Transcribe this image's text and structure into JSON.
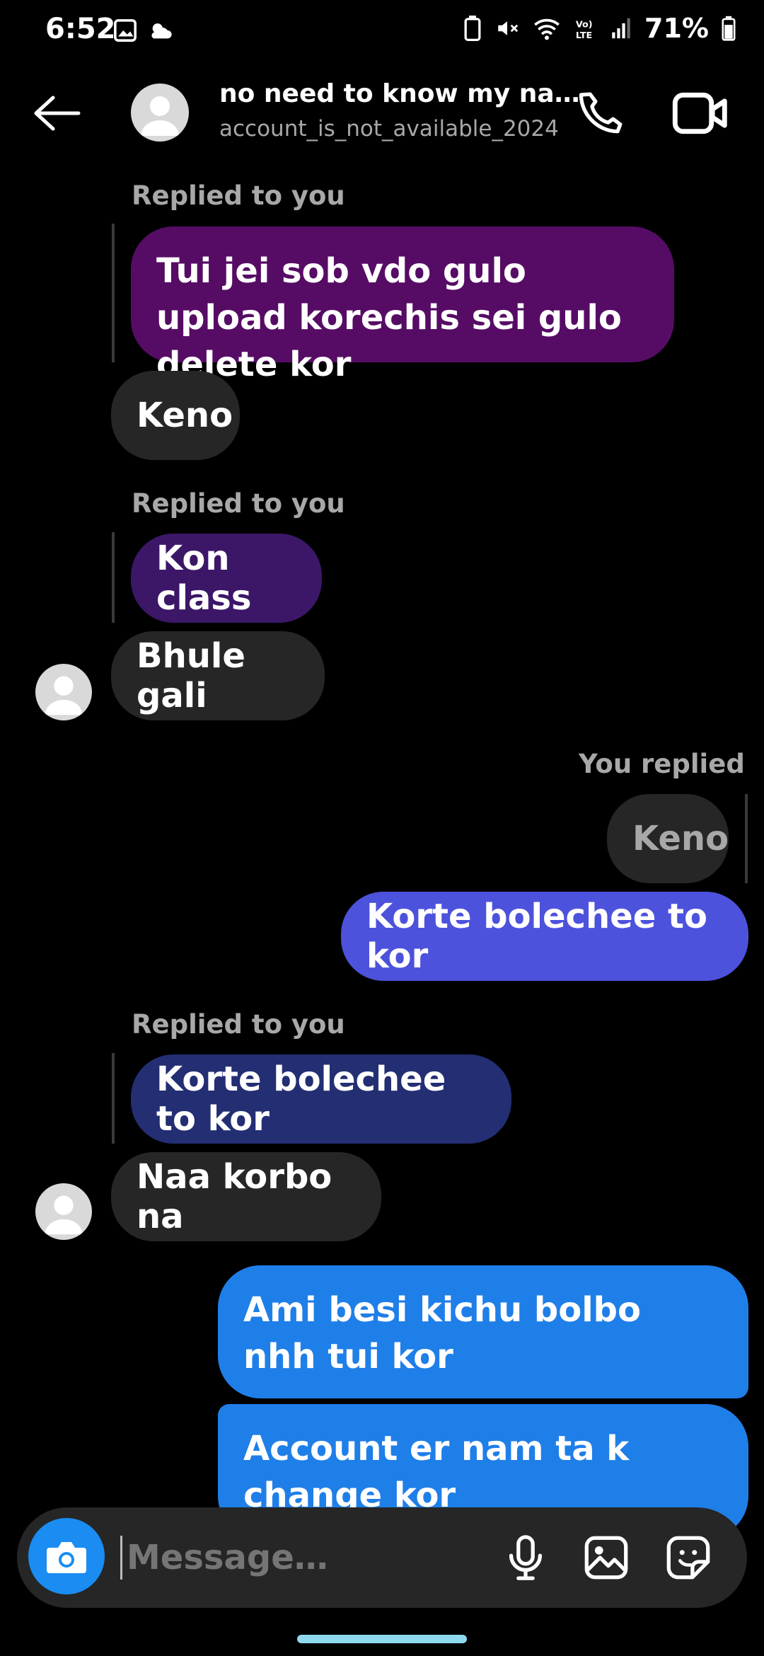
{
  "status": {
    "time": "6:52",
    "battery": "71%"
  },
  "header": {
    "name": "no need to know my na…",
    "username": "account_is_not_available_2024"
  },
  "messages": {
    "replied_to_you": "Replied to you",
    "you_replied": "You replied",
    "m1_quote": "Tui jei sob vdo gulo upload korechis sei gulo delete kor",
    "m1_reply": "Keno",
    "m2_quote": "Kon class",
    "m2_reply": "Bhule gali",
    "m3_quote": "Keno",
    "m3_reply": "Korte bolechee to kor",
    "m4_quote": "Korte bolechee to kor",
    "m4_reply": "Naa korbo na",
    "m5": "Ami besi kichu bolbo nhh tui kor",
    "m6": "Account er nam ta k change kor"
  },
  "composer": {
    "placeholder": "Message…"
  },
  "colors": {
    "purple": "#560c65",
    "purple2": "#3c1768",
    "indigo": "#4d52dc",
    "navy": "#232e73",
    "blue": "#1f7fe8",
    "gray": "#262626"
  }
}
